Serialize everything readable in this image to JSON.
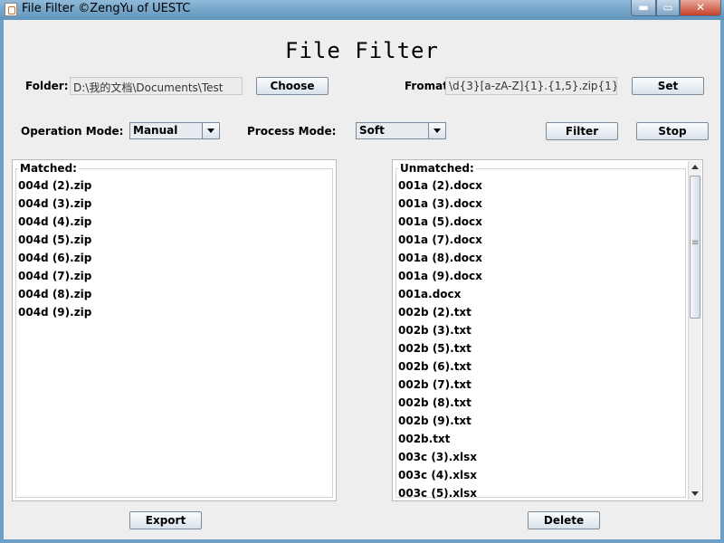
{
  "window": {
    "title": "File Filter ©ZengYu of UESTC",
    "minimize_icon": "minimize-icon",
    "maximize_icon": "maximize-icon",
    "close_icon": "close-icon"
  },
  "heading": "File Filter",
  "folder": {
    "label": "Folder:",
    "value": "D:\\我的文档\\Documents\\Test",
    "choose_label": "Choose"
  },
  "format": {
    "label": "Fromat:",
    "value": "\\d{3}[a-zA-Z]{1}.{1,5}.zip{1}",
    "set_label": "Set"
  },
  "operation_mode": {
    "label": "Operation Mode:",
    "selected": "Manual"
  },
  "process_mode": {
    "label": "Process Mode:",
    "selected": "Soft"
  },
  "actions": {
    "filter_label": "Filter",
    "stop_label": "Stop",
    "export_label": "Export",
    "delete_label": "Delete"
  },
  "matched": {
    "title": "Matched:",
    "items": [
      "004d (2).zip",
      "004d (3).zip",
      "004d (4).zip",
      "004d (5).zip",
      "004d (6).zip",
      "004d (7).zip",
      "004d (8).zip",
      "004d (9).zip"
    ]
  },
  "unmatched": {
    "title": "Unmatched:",
    "items": [
      "001a (2).docx",
      "001a (3).docx",
      "001a (5).docx",
      "001a (7).docx",
      "001a (8).docx",
      "001a (9).docx",
      "001a.docx",
      "002b (2).txt",
      "002b (3).txt",
      "002b (5).txt",
      "002b (6).txt",
      "002b (7).txt",
      "002b (8).txt",
      "002b (9).txt",
      "002b.txt",
      "003c (3).xlsx",
      "003c (4).xlsx",
      "003c (5).xlsx"
    ]
  }
}
